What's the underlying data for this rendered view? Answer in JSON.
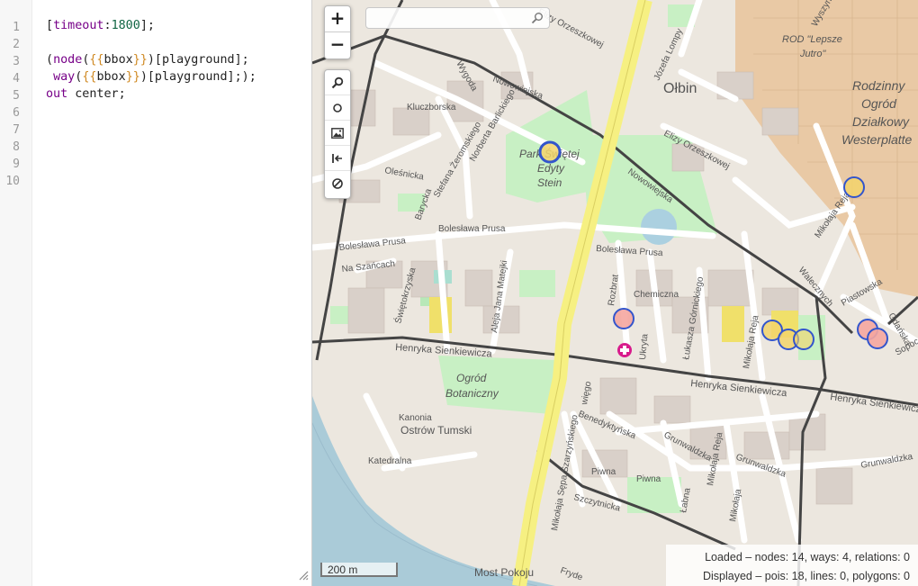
{
  "editor": {
    "line_numbers": [
      "1",
      "2",
      "3",
      "4",
      "5",
      "6",
      "7",
      "8",
      "9",
      "10"
    ],
    "line1": {
      "open": "[",
      "key": "timeout",
      "colon": ":",
      "num": "1800",
      "close": "];"
    },
    "line3": {
      "paren": "(",
      "kw": "node",
      "rest_open": "(",
      "br1": "{{",
      "bbox": "bbox",
      "br2": "}}",
      "rest": ")[playground];"
    },
    "line4": {
      "indent": " ",
      "kw": "way",
      "rest_open": "(",
      "br1": "{{",
      "bbox": "bbox",
      "br2": "}}",
      "rest": ")[playground];);"
    },
    "line5": {
      "kw": "out",
      "rest": " center;"
    }
  },
  "map": {
    "search": {
      "placeholder": "",
      "value": ""
    },
    "zoom": {
      "in_label": "+",
      "out_label": "−"
    },
    "scale_label": "200 m",
    "stats": {
      "loaded": "Loaded – nodes: 14, ways: 4, relations: 0",
      "displayed": "Displayed – pois: 18, lines: 0, polygons: 0"
    },
    "labels": {
      "olbin": "Ołbin",
      "rodzinny1": "Rodzinny",
      "rodzinny2": "Ogród",
      "rodzinny3": "Działkowy",
      "rodzinny4": "Westerplatte",
      "rod1": "ROD \"Lepsze",
      "rod2": "Jutro\"",
      "park1": "Park Świętej",
      "park2": "Edyty",
      "park3": "Stein",
      "ogrod1": "Ogród",
      "ogrod2": "Botaniczny",
      "ostrow": "Ostrów Tumski",
      "kanonia": "Kanonia",
      "katedralna": "Katedralna",
      "most": "Most Pokoju",
      "sienk1": "Henryka Sienkiewicza",
      "sienk2": "Henryka Sienkiewicza",
      "sienk3": "Henryka Sienkiewicza",
      "prusa1": "Bolesława Prusa",
      "prusa2": "Bolesława Prusa",
      "prusa3": "Bolesława Prusa",
      "nowowiejska1": "Nowowiejska",
      "nowowiejska2": "Nowowiejska",
      "chemiczna": "Chemiczna",
      "grunwaldzka1": "Grunwaldzka",
      "grunwaldzka2": "Grunwaldzka",
      "grunwaldzka3": "Grunwaldzka",
      "szczytnicka": "Szczytnicka",
      "piwna1": "Piwna",
      "piwna2": "Piwna",
      "benedyktynska": "Benedyktyńska",
      "kluczborska": "Kluczborska",
      "olesnicka": "Oleśnicka",
      "naszancach": "Na Szańcach",
      "wyszynskiego": "Wyszyńskiego",
      "walecznych": "Walecznych",
      "piastowska": "Piastowska",
      "gdanska": "Gdańska",
      "sopocka": "Sopoc",
      "mikolajareja1": "Mikołaja Reja",
      "mikolajareja2": "Mikołaja Reja",
      "elizy1": "Elizy Orzeszkowej",
      "elizy2": "Elizy Orzeszkowej",
      "jozefa": "Józefa Lompy",
      "wygoda": "Wygoda",
      "zeromskiego": "Stefana Żeromskiego",
      "barycka": "Barycka",
      "norberta": "Norberta Barlickiego",
      "swietokrzyska": "Świętokrzyska",
      "matejki": "Aleja Jana Matejki",
      "rozbrat": "Rozbrat",
      "ukryta": "Ukryta",
      "gornickiego": "Łukasza Górnickiego",
      "szarzynskiego": "Mikołaja Sępa Szarzyńskiego",
      "mikolaja": "Mikołaja",
      "labna": "Łabna",
      "rejka": "Mikołaja Reja",
      "wiego": "więgo",
      "fryd": "Fryde"
    },
    "colors": {
      "poi_outline": "#3355cc",
      "poi_fill_yellow": "#f3d36b",
      "poi_fill_red": "#f5a6a0",
      "road_main": "#f6f082",
      "allotments": "#e9c9a5"
    }
  }
}
